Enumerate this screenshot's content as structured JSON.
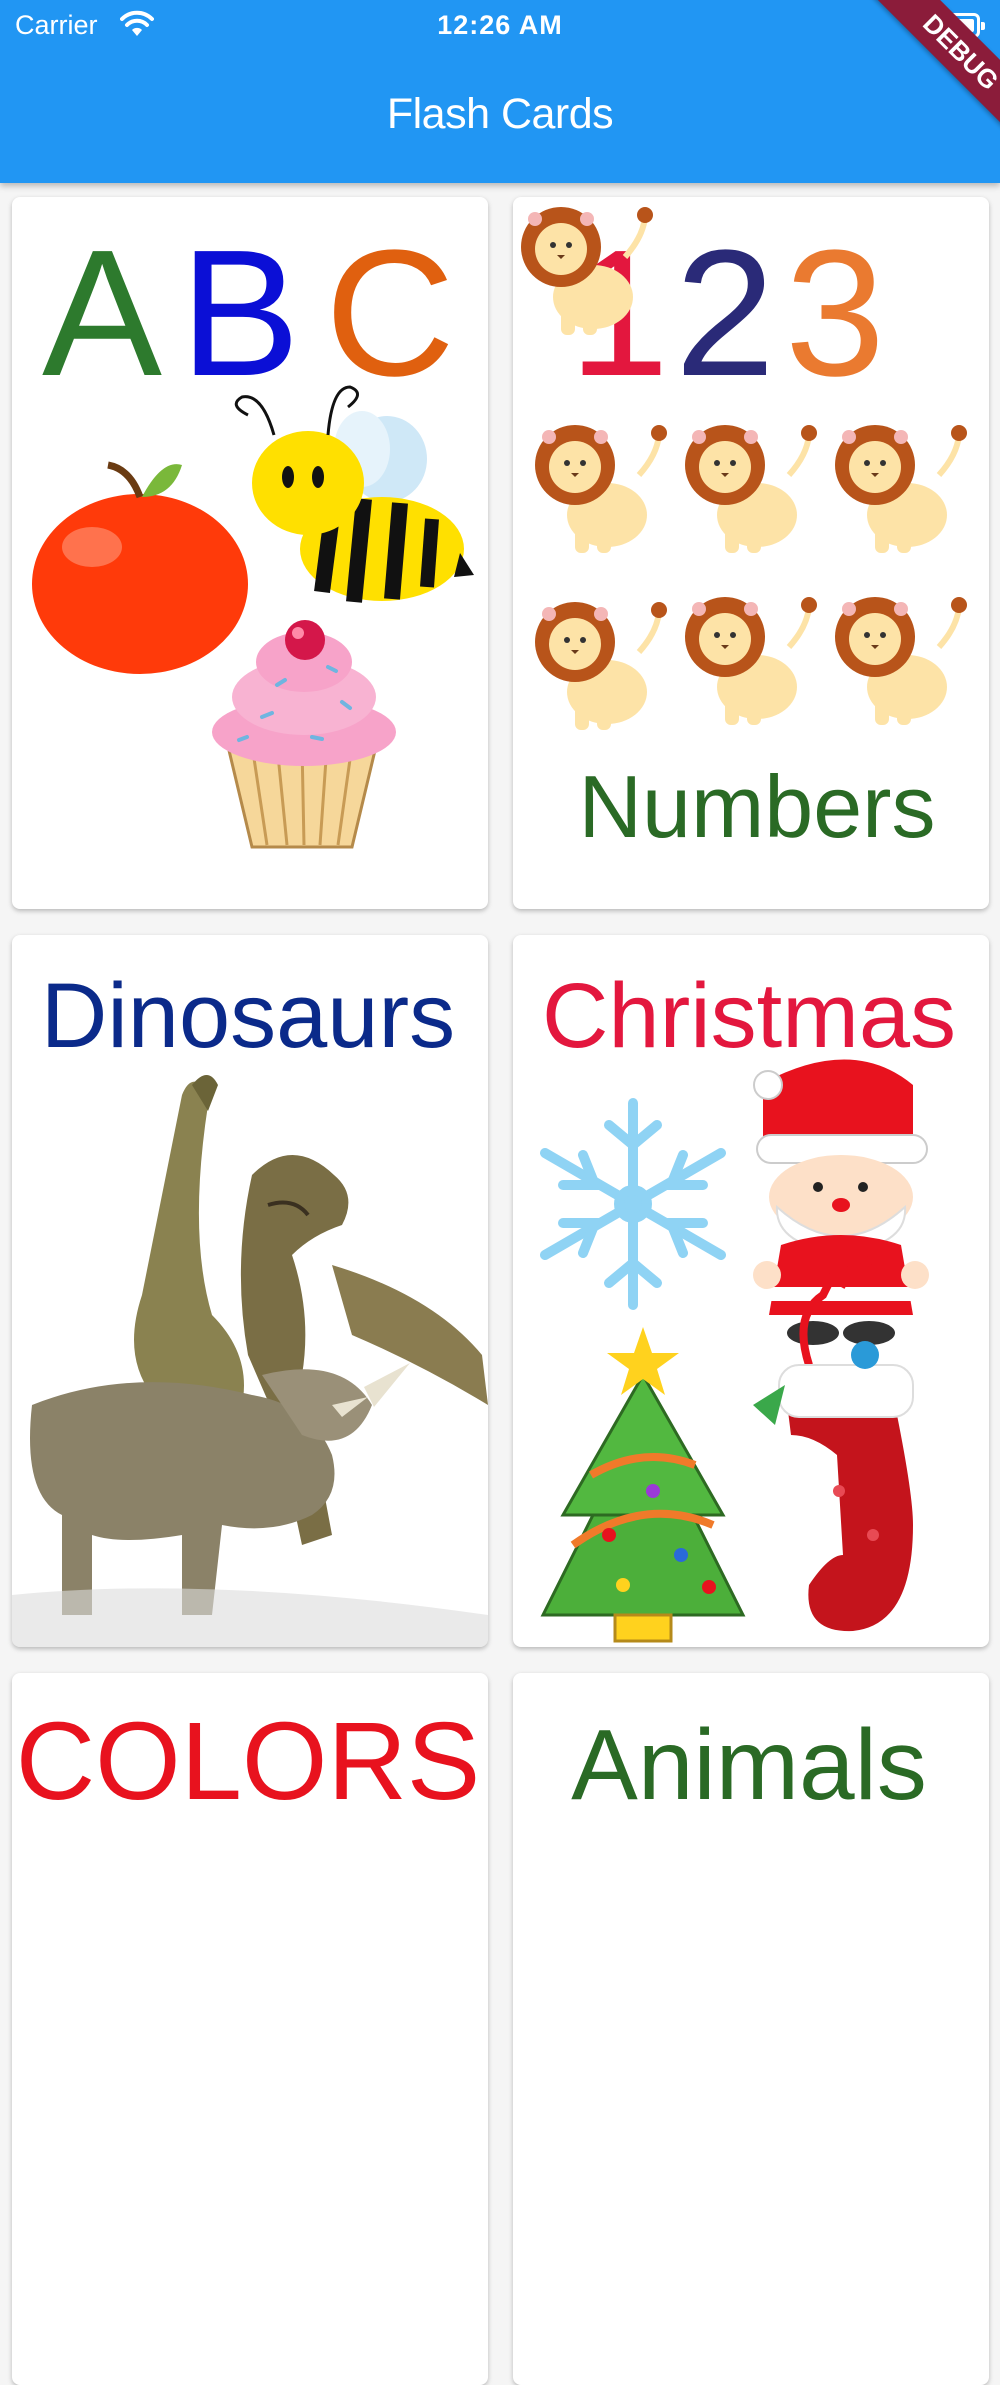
{
  "status_bar": {
    "carrier": "Carrier",
    "time": "12:26 AM"
  },
  "app_bar": {
    "title": "Flash Cards",
    "debug_banner": "DEBUG",
    "color": "#2196f3"
  },
  "cards": [
    {
      "id": "abc",
      "heading": "ABC",
      "letters": [
        "A",
        "B",
        "C"
      ],
      "illustrations": [
        "apple",
        "bee",
        "cupcake"
      ]
    },
    {
      "id": "numbers",
      "digits": [
        "1",
        "2",
        "3"
      ],
      "label": "Numbers",
      "illustrations": [
        "lion"
      ]
    },
    {
      "id": "dinosaurs",
      "label": "Dinosaurs",
      "illustrations": [
        "dinosaur-group"
      ]
    },
    {
      "id": "christmas",
      "label": "Christmas",
      "illustrations": [
        "snowflake",
        "santa",
        "christmas-tree",
        "stocking"
      ]
    },
    {
      "id": "colors",
      "label": "COLORS"
    },
    {
      "id": "animals",
      "label": "Animals"
    }
  ]
}
